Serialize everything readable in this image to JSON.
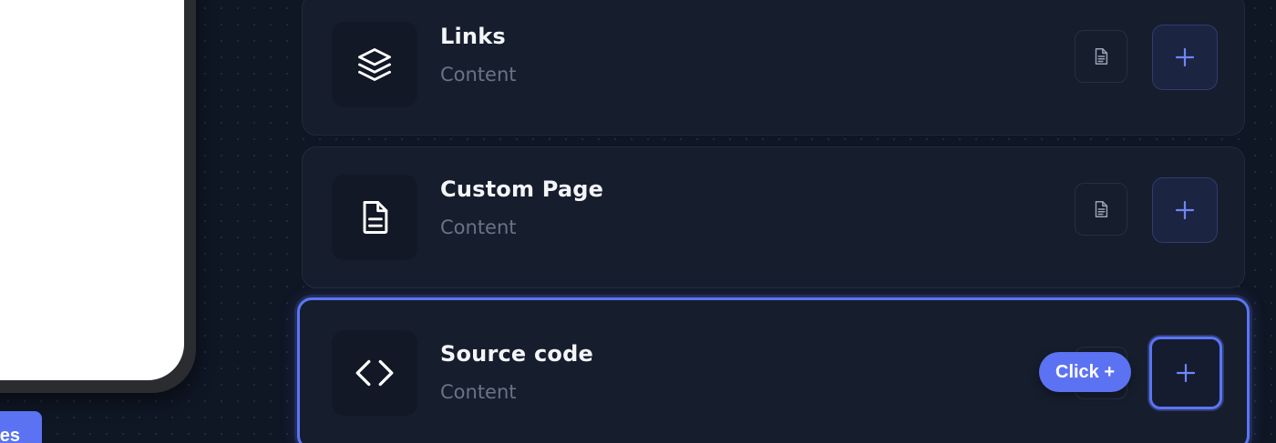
{
  "preview": {
    "button_label": "es"
  },
  "cards": [
    {
      "title": "Links",
      "subtitle": "Content",
      "icon": "layers-icon",
      "selected": false
    },
    {
      "title": "Custom Page",
      "subtitle": "Content",
      "icon": "document-icon",
      "selected": false
    },
    {
      "title": "Source code",
      "subtitle": "Content",
      "icon": "code-icon",
      "selected": true
    }
  ],
  "tooltip": {
    "label": "Click +"
  },
  "colors": {
    "background": "#0f1624",
    "card": "#161d2c",
    "accent": "#5b73f2",
    "title_text": "#f3f5f9",
    "subtitle_text": "#6a7385"
  }
}
